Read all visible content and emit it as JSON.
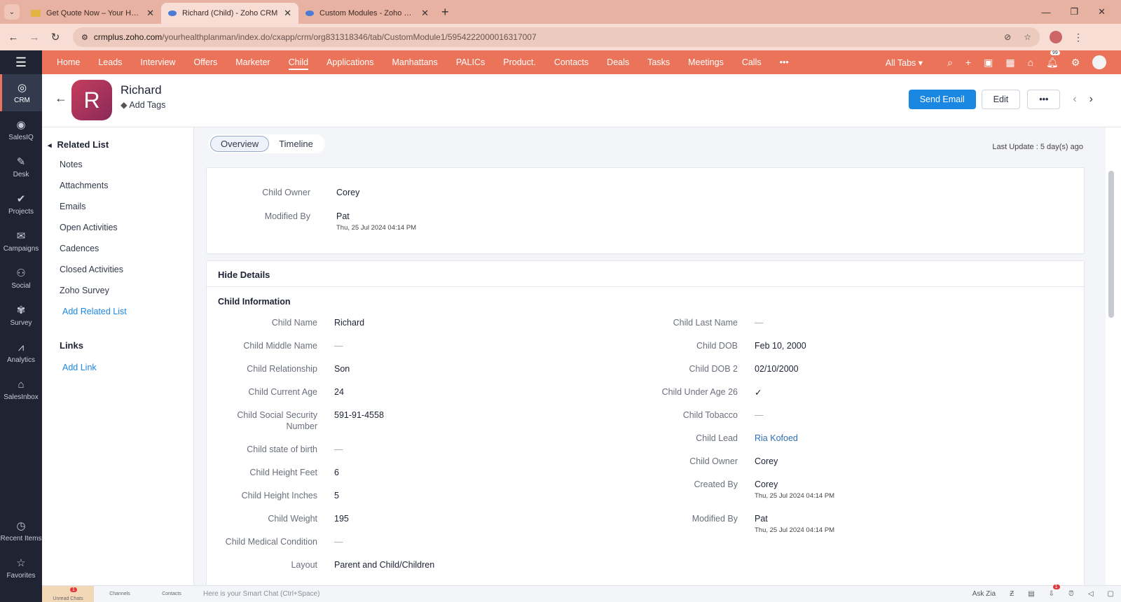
{
  "browser": {
    "tabs": [
      {
        "title": "Get Quote Now – Your Health P",
        "color": "#e3b341"
      },
      {
        "title": "Richard (Child) - Zoho CRM",
        "color": "#4b7bd6",
        "active": true
      },
      {
        "title": "Custom Modules - Zoho CRM",
        "color": "#4b7bd6"
      }
    ],
    "url_domain": "crmplus.zoho.com",
    "url_path": "/yourhealthplanman/index.do/cxapp/crm/org831318346/tab/CustomModule1/5954222000016317007"
  },
  "rail": {
    "items": [
      "CRM",
      "SalesIQ",
      "Desk",
      "Projects",
      "Campaigns",
      "Social",
      "Survey",
      "Analytics",
      "SalesInbox"
    ],
    "bottom": [
      "Recent Items",
      "Favorites"
    ]
  },
  "nav": {
    "tabs": [
      "Home",
      "Leads",
      "Interview",
      "Offers",
      "Marketer",
      "Child",
      "Applications",
      "Manhattans",
      "PALICs",
      "Product.",
      "Contacts",
      "Deals",
      "Tasks",
      "Meetings",
      "Calls"
    ],
    "more": "•••",
    "all_tabs": "All Tabs ▾",
    "notif_count": "99"
  },
  "record": {
    "initial": "R",
    "name": "Richard",
    "add_tags": "Add Tags",
    "send_email": "Send Email",
    "edit": "Edit",
    "more": "•••"
  },
  "related": {
    "title": "Related List",
    "items": [
      "Notes",
      "Attachments",
      "Emails",
      "Open Activities",
      "Cadences",
      "Closed Activities",
      "Zoho Survey"
    ],
    "add": "Add Related List",
    "links_title": "Links",
    "add_link": "Add Link"
  },
  "view": {
    "tabs": [
      "Overview",
      "Timeline"
    ],
    "last_update": "Last Update : 5 day(s) ago"
  },
  "summary": {
    "owner_label": "Child Owner",
    "owner": "Corey",
    "modified_label": "Modified By",
    "modified": "Pat",
    "modified_time": "Thu, 25 Jul 2024 04:14 PM"
  },
  "details": {
    "toggle": "Hide Details",
    "section": "Child Information",
    "left": [
      {
        "label": "Child Name",
        "value": "Richard"
      },
      {
        "label": "Child Middle Name",
        "value": "—"
      },
      {
        "label": "Child Relationship",
        "value": "Son"
      },
      {
        "label": "Child Current Age",
        "value": "24"
      },
      {
        "label": "Child Social Security Number",
        "value": "591-91-4558"
      },
      {
        "label": "Child state of birth",
        "value": "—"
      },
      {
        "label": "Child Height Feet",
        "value": "6"
      },
      {
        "label": "Child Height Inches",
        "value": "5"
      },
      {
        "label": "Child Weight",
        "value": "195"
      },
      {
        "label": "Child Medical Condition",
        "value": "—"
      },
      {
        "label": "Layout",
        "value": "Parent and Child/Children"
      }
    ],
    "right": [
      {
        "label": "Child Last Name",
        "value": "—"
      },
      {
        "label": "Child DOB",
        "value": "Feb 10, 2000"
      },
      {
        "label": "Child DOB 2",
        "value": "02/10/2000"
      },
      {
        "label": "Child Under Age 26",
        "value": "✓"
      },
      {
        "label": "Child Tobacco",
        "value": "—"
      },
      {
        "label": "Child Lead",
        "value": "Ria Kofoed"
      },
      {
        "label": "Child Owner",
        "value": "Corey"
      },
      {
        "label": "Created By",
        "value": "Corey",
        "sub": "Thu, 25 Jul 2024 04:14 PM"
      },
      {
        "label": "Modified By",
        "value": "Pat",
        "sub": "Thu, 25 Jul 2024 04:14 PM"
      }
    ]
  },
  "bottom": {
    "items": [
      "Unread Chats",
      "Channels",
      "Contacts"
    ],
    "smart_chat": "Here is your Smart Chat (Ctrl+Space)",
    "ask_zia": "Ask Zia",
    "chat_badge": "1",
    "right_badge": "1"
  }
}
